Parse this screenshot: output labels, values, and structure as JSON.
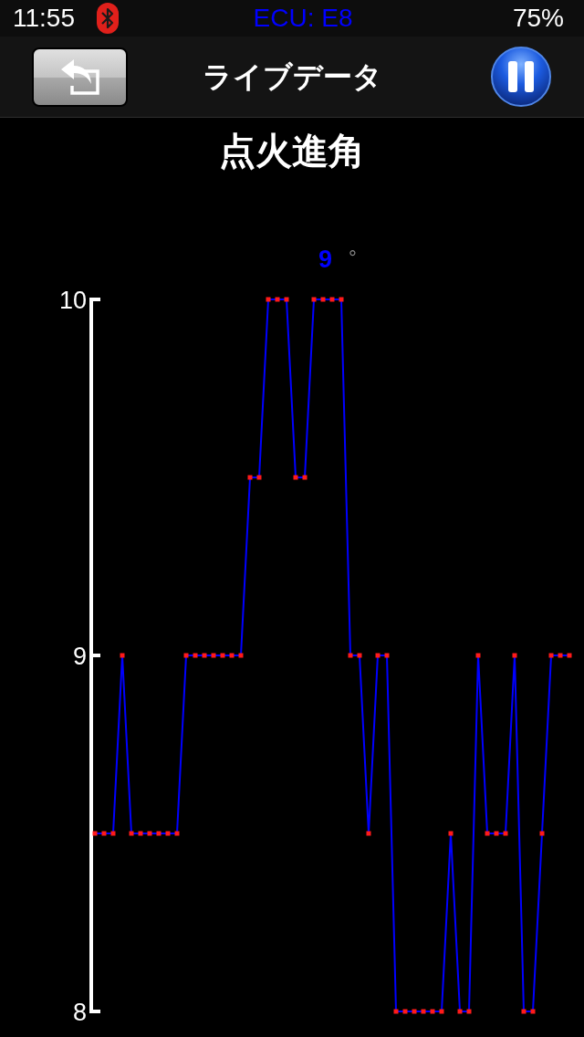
{
  "status_bar": {
    "time": "11:55",
    "ecu": "ECU: E8",
    "battery": "75%"
  },
  "nav_bar": {
    "title": "ライブデータ"
  },
  "sensor": {
    "name": "点火進角",
    "reading": "9",
    "unit": "°",
    "chart_data": {
      "type": "line",
      "ylim": [
        8,
        10
      ],
      "yticks": [
        8,
        9,
        10
      ],
      "series": [
        {
          "color": "#0000ff",
          "marker": "square",
          "values": [
            8.5,
            8.5,
            8.5,
            9,
            8.5,
            8.5,
            8.5,
            8.5,
            8.5,
            8.5,
            9,
            9,
            9,
            9,
            9,
            9,
            9,
            9.5,
            9.5,
            10,
            10,
            10,
            9.5,
            9.5,
            10,
            10,
            10,
            10,
            9,
            9,
            8.5,
            9,
            9,
            8,
            8,
            8,
            8,
            8,
            8,
            8.5,
            8,
            8,
            9,
            8.5,
            8.5,
            8.5,
            9,
            8,
            8,
            8.5,
            9,
            9,
            9
          ]
        }
      ]
    }
  }
}
